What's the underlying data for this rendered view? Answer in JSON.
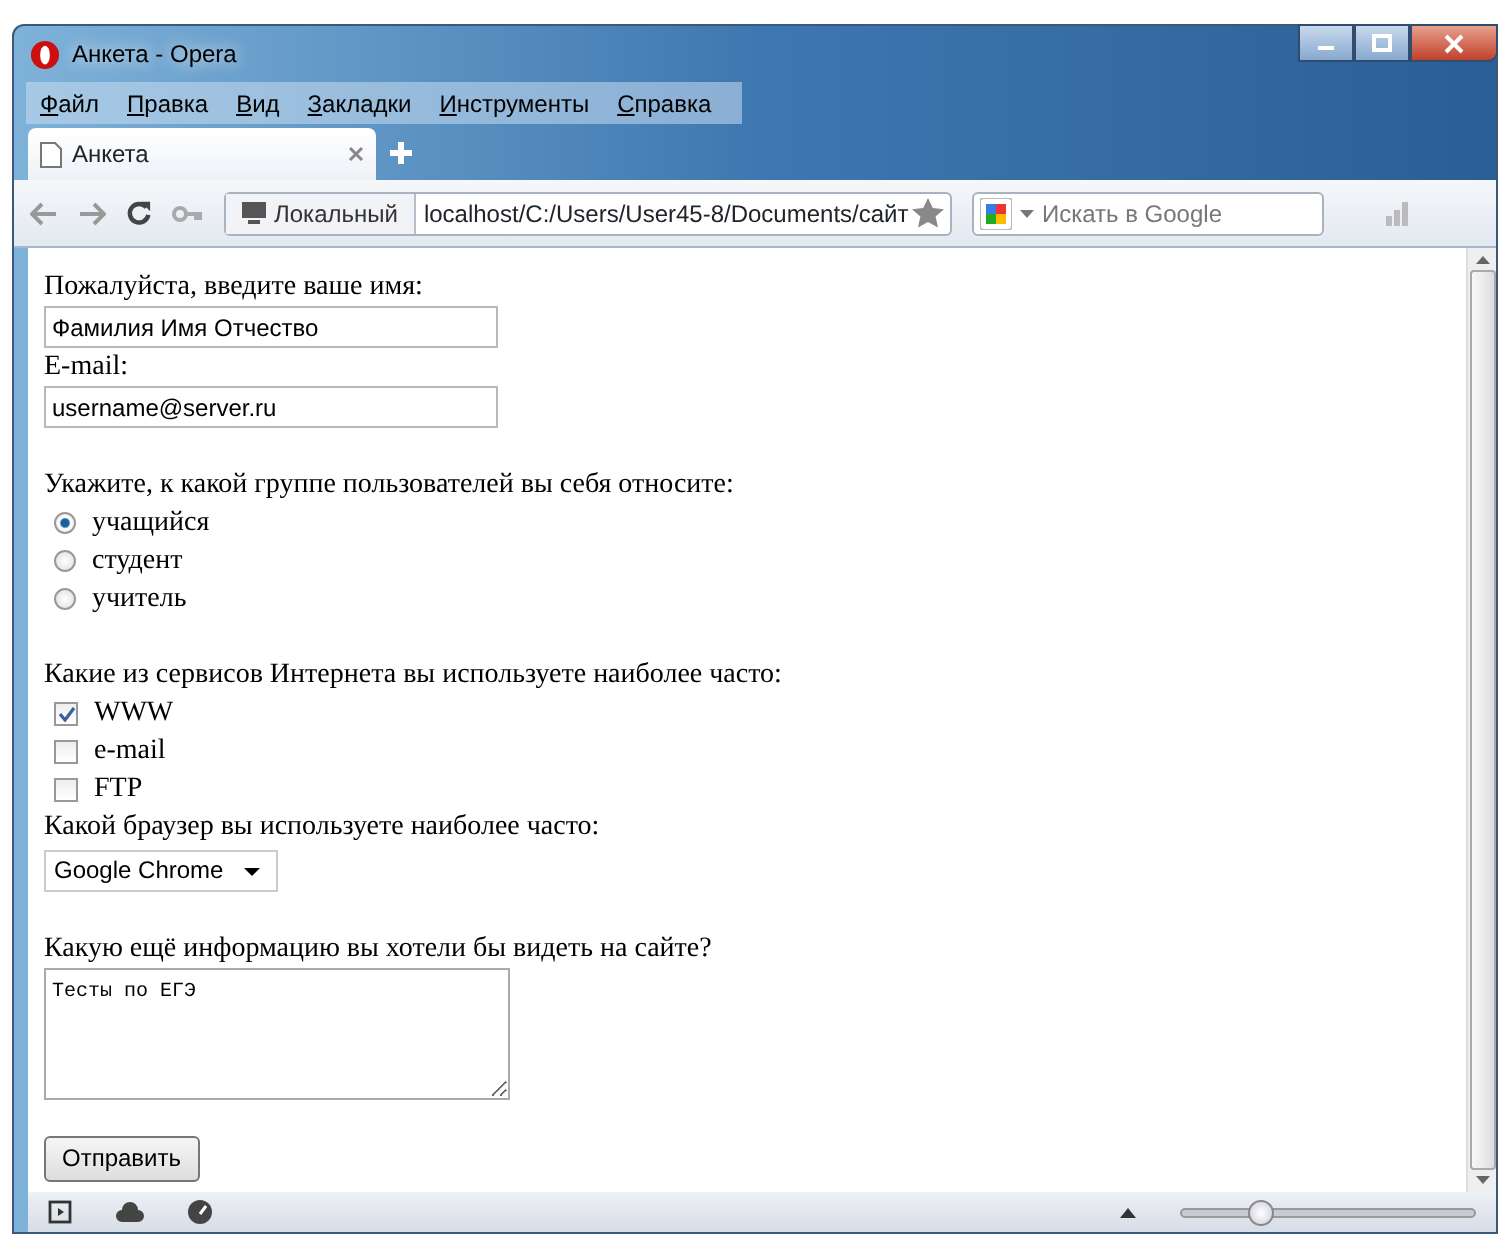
{
  "window": {
    "title": "Анкета - Opera"
  },
  "menu": [
    "Файл",
    "Правка",
    "Вид",
    "Закладки",
    "Инструменты",
    "Справка"
  ],
  "tabs": [
    {
      "label": "Анкета",
      "selected": true
    }
  ],
  "address_bar": {
    "security_label": "Локальный",
    "url": "localhost/C:/Users/User45-8/Documents/сайт"
  },
  "search": {
    "placeholder": "Искать в Google"
  },
  "form": {
    "name_label": "Пожалуйста, введите ваше имя:",
    "name_value": "Фамилия Имя Отчество",
    "email_label": "E-mail:",
    "email_value": "username@server.ru",
    "group_label": "Укажите, к какой группе пользователей вы себя относите:",
    "groups": [
      {
        "label": "учащийся",
        "selected": true
      },
      {
        "label": "студент",
        "selected": false
      },
      {
        "label": "учитель",
        "selected": false
      }
    ],
    "services_label": "Какие из сервисов Интернета вы используете наиболее часто:",
    "services": [
      {
        "label": "WWW",
        "checked": true
      },
      {
        "label": "e-mail",
        "checked": false
      },
      {
        "label": "FTP",
        "checked": false
      }
    ],
    "browser_label": "Какой браузер вы используете наиболее часто:",
    "browser_value": "Google Chrome",
    "info_label": "Какую ещё информацию вы хотели бы видеть на сайте?",
    "info_value": "Тесты по ЕГЭ",
    "submit": "Отправить"
  },
  "status_bar": {
    "zoom": {
      "level": 0.27
    }
  }
}
